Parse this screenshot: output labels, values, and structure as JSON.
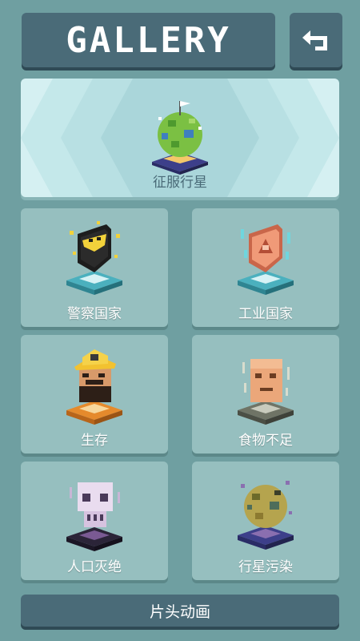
{
  "header": {
    "title": "GALLERY",
    "back_icon": "return-arrow-icon"
  },
  "featured": {
    "label": "征服行星",
    "icon": "conquered-planet-icon"
  },
  "achievements": [
    {
      "label": "警察国家",
      "icon": "police-shield-icon"
    },
    {
      "label": "工业国家",
      "icon": "industrial-shield-icon"
    },
    {
      "label": "生存",
      "icon": "miner-head-icon"
    },
    {
      "label": "食物不足",
      "icon": "starving-head-icon"
    },
    {
      "label": "人口灭绝",
      "icon": "skull-icon"
    },
    {
      "label": "行星污染",
      "icon": "polluted-planet-icon"
    }
  ],
  "footer": {
    "intro_label": "片头动画"
  },
  "colors": {
    "background": "#6f9fa1",
    "header_bar": "#4a6b78",
    "card": "#96bfbf",
    "featured_card": "#d5f0f2"
  }
}
